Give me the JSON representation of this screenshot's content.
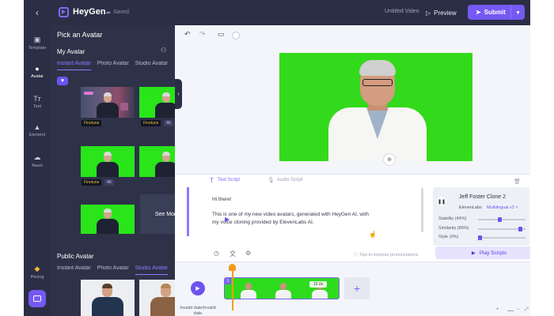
{
  "topbar": {
    "back_icon": "chevron-left-icon",
    "brand": "HeyGen",
    "saved_label": "Saved",
    "doc_title": "Untitled Video",
    "preview_label": "Preview",
    "submit_label": "Submit",
    "accent_color": "#7559f2"
  },
  "rail": {
    "items": [
      {
        "label": "Template",
        "icon": "template-icon"
      },
      {
        "label": "Avatar",
        "icon": "avatar-icon",
        "active": true
      },
      {
        "label": "Text",
        "icon": "text-icon"
      },
      {
        "label": "Element",
        "icon": "element-icon"
      },
      {
        "label": "Asset",
        "icon": "upload-icon"
      }
    ],
    "pricing_label": "Pricing"
  },
  "panel": {
    "title": "Pick an Avatar",
    "my_avatar_title": "My Avatar",
    "my_tabs": [
      "Instant Avatar",
      "Photo Avatar",
      "Studio Avatar"
    ],
    "tag_finetune": "Finetune",
    "tag_4k": "4K",
    "see_more": "See More",
    "public_title": "Public Avatar",
    "public_tabs": [
      "Instant Avatar",
      "Photo Avatar",
      "Studio Avatar"
    ]
  },
  "script": {
    "tab_text": "Text Script",
    "tab_audio": "Audio Script",
    "line1": "Hi there!",
    "line2": "This is one of my new video avatars, generated with HeyGen AI, with",
    "line3": "my voice cloning provided by ElevenLabs AI.",
    "tips": "Tips to improve pronunciations",
    "play_scripts": "Play Scripts"
  },
  "voice": {
    "name": "Jeff Foster Clone 2",
    "provider": "ElevenLabs",
    "model": "Multilingual v2",
    "sliders": [
      {
        "label": "Stability (44%)",
        "value": 0.44
      },
      {
        "label": "Similarity (89%)",
        "value": 0.89
      },
      {
        "label": "Style (0%)",
        "value": 0.0
      }
    ]
  },
  "timeline": {
    "clip_number": "1",
    "clip_duration": "15.0s",
    "invalid_date": "Invalid date/Invalid date"
  }
}
